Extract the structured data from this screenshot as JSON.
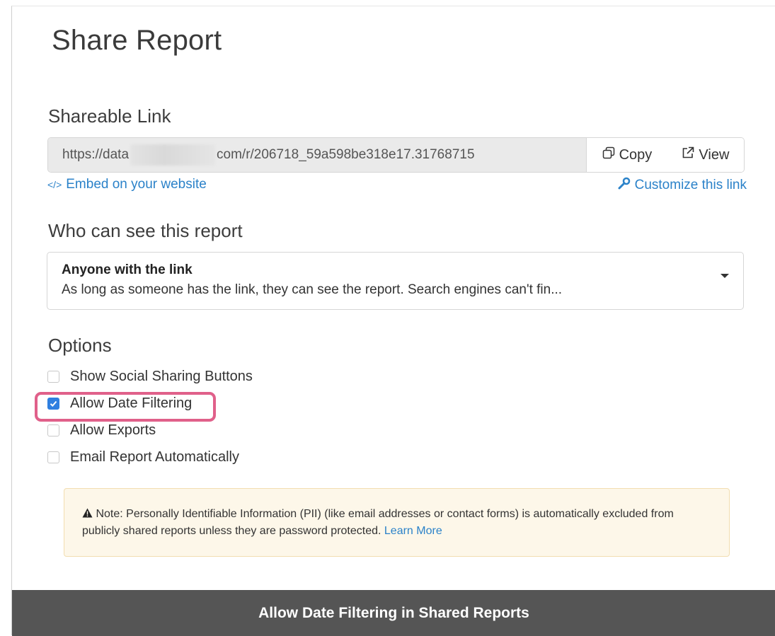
{
  "dialog": {
    "title": "Share Report"
  },
  "shareable_link": {
    "heading": "Shareable Link",
    "url_prefix": "https://data",
    "url_suffix": "com/r/206718_59a598be318e17.31768715",
    "copy_label": "Copy",
    "view_label": "View",
    "embed_label": "Embed on your website",
    "customize_label": "Customize this link"
  },
  "visibility": {
    "heading": "Who can see this report",
    "selected_title": "Anyone with the link",
    "selected_desc": "As long as someone has the link, they can see the report. Search engines can't fin..."
  },
  "options": {
    "heading": "Options",
    "items": [
      {
        "label": "Show Social Sharing Buttons",
        "checked": false
      },
      {
        "label": "Allow Date Filtering",
        "checked": true
      },
      {
        "label": "Allow Exports",
        "checked": false
      },
      {
        "label": "Email Report Automatically",
        "checked": false
      }
    ]
  },
  "note": {
    "text": "Note: Personally Identifiable Information (PII) (like email addresses or contact forms) is automatically excluded from publicly shared reports unless they are password protected.",
    "learn_more": "Learn More"
  },
  "caption": "Allow Date Filtering in Shared Reports",
  "colors": {
    "accent": "#2f7fe0",
    "link": "#2b82c9",
    "highlight": "#e0608a",
    "note_bg": "#fdf7e9",
    "caption_bg": "#555555"
  }
}
